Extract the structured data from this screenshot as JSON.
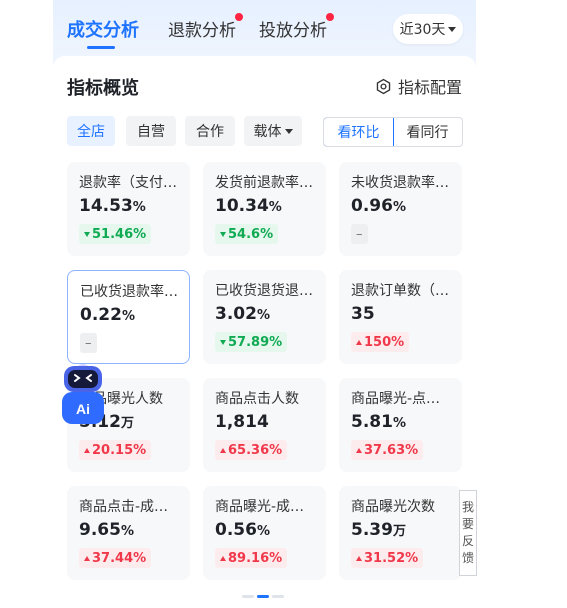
{
  "header": {
    "tabs": [
      {
        "label": "成交分析",
        "active": true,
        "has_dot": false
      },
      {
        "label": "退款分析",
        "active": false,
        "has_dot": true
      },
      {
        "label": "投放分析",
        "active": false,
        "has_dot": true
      }
    ],
    "range_label": "近30天"
  },
  "overview": {
    "title": "指标概览",
    "config_label": "指标配置",
    "filters": [
      "全店",
      "自营",
      "合作",
      "载体"
    ],
    "compare": [
      "看环比",
      "看同行"
    ]
  },
  "metrics": [
    {
      "name": "退款率（支付…",
      "value": "14.53",
      "unit": "%",
      "change": "51.46%",
      "trend": "down"
    },
    {
      "name": "发货前退款率…",
      "value": "10.34",
      "unit": "%",
      "change": "54.6%",
      "trend": "down"
    },
    {
      "name": "未收货退款率…",
      "value": "0.96",
      "unit": "%",
      "change": "–",
      "trend": "none"
    },
    {
      "name": "已收货退款率…",
      "value": "0.22",
      "unit": "%",
      "change": "–",
      "trend": "none"
    },
    {
      "name": "已收货退货退…",
      "value": "3.02",
      "unit": "%",
      "change": "57.89%",
      "trend": "down"
    },
    {
      "name": "退款订单数（…",
      "value": "35",
      "unit": "",
      "change": "150%",
      "trend": "up"
    },
    {
      "name": "商品曝光人数",
      "value": "5.12",
      "unit": "万",
      "change": "20.15%",
      "trend": "up"
    },
    {
      "name": "商品点击人数",
      "value": "1,814",
      "unit": "",
      "change": "65.36%",
      "trend": "up"
    },
    {
      "name": "商品曝光-点…",
      "value": "5.81",
      "unit": "%",
      "change": "37.63%",
      "trend": "up"
    },
    {
      "name": "商品点击-成…",
      "value": "9.65",
      "unit": "%",
      "change": "37.44%",
      "trend": "up"
    },
    {
      "name": "商品曝光-成…",
      "value": "0.56",
      "unit": "%",
      "change": "89.16%",
      "trend": "up"
    },
    {
      "name": "商品曝光次数",
      "value": "5.39",
      "unit": "万",
      "change": "31.52%",
      "trend": "up"
    }
  ],
  "assistant_label": "Ai",
  "feedback_label": "我要反馈",
  "colors": {
    "accent": "#1f74ff",
    "down": "#0faa52",
    "up": "#f0384a"
  }
}
